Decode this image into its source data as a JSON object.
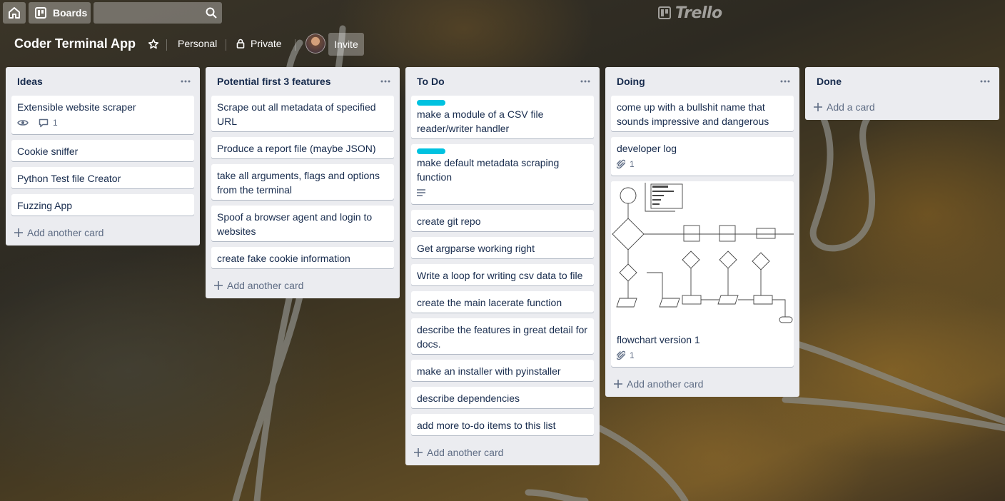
{
  "header": {
    "boards_label": "Boards",
    "search_value": "",
    "logo_text": "Trello"
  },
  "board": {
    "title": "Coder Terminal App",
    "team_label": "Personal",
    "visibility_label": "Private",
    "invite_label": "Invite"
  },
  "colors": {
    "label_cyan": "#00c2e0",
    "list_bg": "#ebecf0",
    "text": "#172b4d"
  },
  "lists": [
    {
      "title": "Ideas",
      "add_label": "Add another card",
      "cards": [
        {
          "title": "Extensible website scraper",
          "watching": true,
          "comments": "1"
        },
        {
          "title": "Cookie sniffer"
        },
        {
          "title": "Python Test file Creator"
        },
        {
          "title": "Fuzzing App"
        }
      ]
    },
    {
      "title": "Potential first 3 features",
      "add_label": "Add another card",
      "cards": [
        {
          "title": "Scrape out all metadata of specified URL"
        },
        {
          "title": "Produce a report file (maybe JSON)"
        },
        {
          "title": "take all arguments, flags and options from the terminal"
        },
        {
          "title": "Spoof a browser agent and login to websites"
        },
        {
          "title": "create fake cookie information"
        }
      ]
    },
    {
      "title": "To Do",
      "add_label": "Add another card",
      "cards": [
        {
          "title": "make a module of a CSV file reader/writer handler",
          "label": "cyan"
        },
        {
          "title": "make default metadata scraping function",
          "label": "cyan",
          "description": true
        },
        {
          "title": "create git repo"
        },
        {
          "title": "Get argparse working right"
        },
        {
          "title": "Write a loop for writing csv data to file"
        },
        {
          "title": "create the main lacerate function"
        },
        {
          "title": "describe the features in great detail for docs."
        },
        {
          "title": "make an installer with pyinstaller"
        },
        {
          "title": "describe dependencies"
        },
        {
          "title": "add more to-do items to this list"
        }
      ]
    },
    {
      "title": "Doing",
      "add_label": "Add another card",
      "cards": [
        {
          "title": "come up with a bullshit name that sounds impressive and dangerous"
        },
        {
          "title": "developer log",
          "attachments": "1"
        },
        {
          "title": "flowchart version 1",
          "attachments": "1",
          "cover": "flowchart"
        }
      ]
    },
    {
      "title": "Done",
      "add_label": "Add a card",
      "cards": []
    }
  ]
}
